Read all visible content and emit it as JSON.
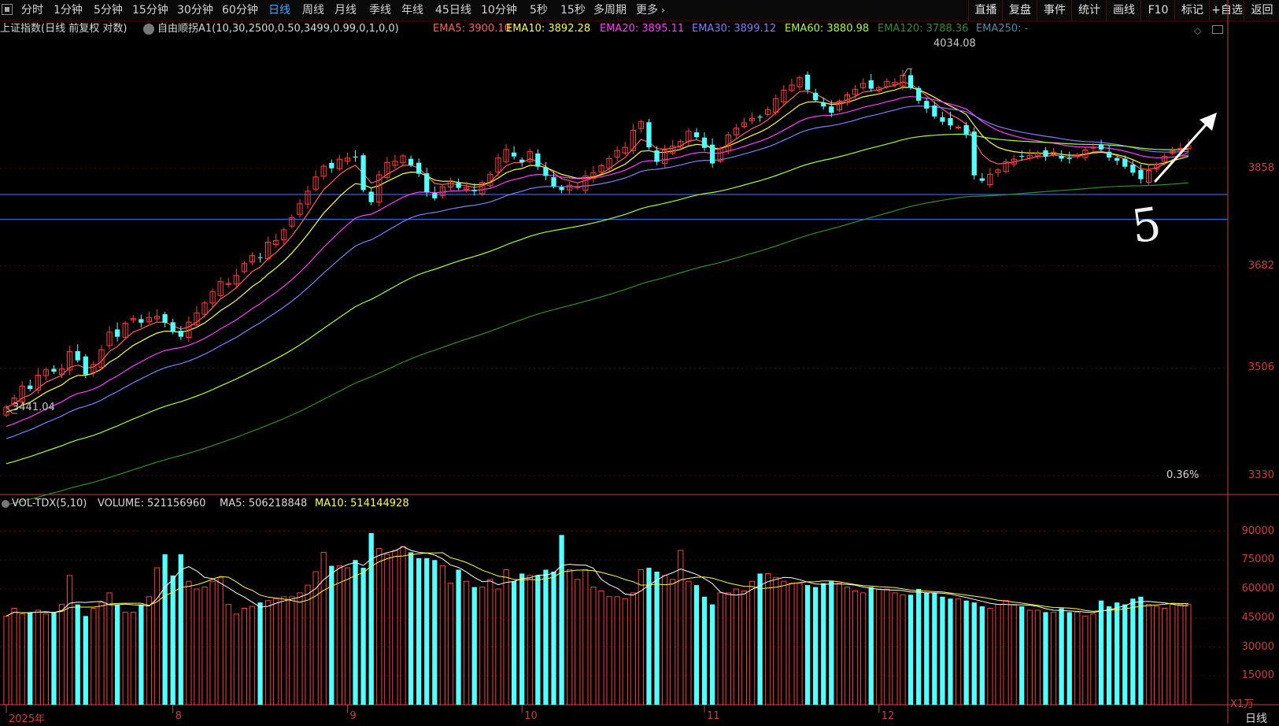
{
  "toolbar": {
    "tabs": [
      "分时",
      "1分钟",
      "5分钟",
      "15分钟",
      "30分钟",
      "60分钟",
      "日线",
      "周线",
      "月线",
      "季线",
      "年线",
      "45日线",
      "10分钟",
      "5秒",
      "15秒",
      "多周期",
      "更多"
    ],
    "active_tab": "日线",
    "right": [
      "直播",
      "复盘",
      "事件",
      "统计",
      "画线",
      "F10",
      "标记",
      "+自选",
      "返回"
    ]
  },
  "main_info": {
    "index_label": "上证指数(日线 前复权 对数)",
    "formula": "自由顺拐A1(10,30,2500,0.50,3499,0.99,0,1,0,0)",
    "ema": [
      {
        "label": "EMA5: 3900.10",
        "color": "#ff6060"
      },
      {
        "label": "EMA10: 3892.28",
        "color": "#ffff40"
      },
      {
        "label": "EMA20: 3895.11",
        "color": "#ff3cff"
      },
      {
        "label": "EMA30: 3899.12",
        "color": "#7f7fff"
      },
      {
        "label": "EMA60: 3880.98",
        "color": "#a6ff2f"
      },
      {
        "label": "EMA120: 3788.36",
        "color": "#2f8f2f"
      },
      {
        "label": "EMA250: -",
        "color": "#4a8fa8"
      }
    ]
  },
  "vol_info": {
    "title": "VOL-TDX(5,10)",
    "volume": "VOLUME: 521156960",
    "ma5": "MA5: 506218848",
    "ma10": "MA10: 514144928",
    "ma10_color": "#ffff40"
  },
  "annotations": {
    "high_label": "4034.08",
    "low_label": "3441.04",
    "percent_label": "0.36%",
    "handwritten": "5"
  },
  "price_axis_labels": [
    "3858",
    "3682",
    "3506",
    "3330"
  ],
  "volume_axis_labels": [
    "90000",
    "75000",
    "60000",
    "45000",
    "30000",
    "15000"
  ],
  "volume_unit": "X1万",
  "x_labels": [
    "2025年",
    "8",
    "9",
    "10",
    "11",
    "12"
  ],
  "bottom_right": "日线",
  "colors": {
    "up": "#ff3b3b",
    "down": "#54ffff",
    "grid": "#5a0000",
    "hline": "#2f6ad8",
    "axis": "#d23c3c"
  },
  "chart_data": [
    {
      "type": "candlestick",
      "title": "上证指数 日线",
      "y_scale": "log",
      "ylim": [
        3300,
        4110
      ],
      "y_ticks": [
        3858,
        3682,
        3506,
        3330
      ],
      "x_month_labels": [
        "2025年",
        "8",
        "9",
        "10",
        "11",
        "12"
      ],
      "horizontal_lines": [
        3810,
        3765
      ],
      "marked_high": 4034.08,
      "marked_low": 3441.04,
      "closes": [
        3441,
        3456,
        3476,
        3471,
        3494,
        3503,
        3500,
        3505,
        3534,
        3519,
        3495,
        3512,
        3537,
        3567,
        3559,
        3582,
        3590,
        3583,
        3592,
        3594,
        3583,
        3567,
        3559,
        3584,
        3600,
        3617,
        3637,
        3654,
        3651,
        3665,
        3686,
        3700,
        3696,
        3724,
        3727,
        3746,
        3768,
        3793,
        3816,
        3842,
        3862,
        3858,
        3875,
        3877,
        3878,
        3818,
        3796,
        3846,
        3869,
        3871,
        3881,
        3864,
        3848,
        3814,
        3803,
        3824,
        3835,
        3822,
        3823,
        3816,
        3832,
        3847,
        3877,
        3893,
        3880,
        3869,
        3889,
        3861,
        3844,
        3825,
        3818,
        3827,
        3824,
        3844,
        3850,
        3863,
        3876,
        3891,
        3897,
        3929,
        3945,
        3897,
        3870,
        3892,
        3899,
        3908,
        3927,
        3916,
        3896,
        3867,
        3895,
        3920,
        3933,
        3943,
        3951,
        3953,
        3968,
        3989,
        4005,
        4015,
        4029,
        4006,
        3986,
        3974,
        3962,
        3984,
        3996,
        4007,
        4018,
        4008,
        4010,
        4022,
        4020,
        4034,
        4010,
        3985,
        3970,
        3955,
        3945,
        3938,
        3935,
        3920,
        3845,
        3835,
        3847,
        3855,
        3870,
        3875,
        3880,
        3882,
        3887,
        3880,
        3888,
        3876,
        3875,
        3883,
        3892,
        3897,
        3893,
        3878,
        3872,
        3861,
        3850,
        3838,
        3854,
        3866,
        3880,
        3890,
        3895,
        3900
      ],
      "volume": {
        "unit": "万",
        "ylim": [
          0,
          100000
        ],
        "y_ticks": [
          90000,
          75000,
          60000,
          45000,
          30000,
          15000
        ],
        "values": [
          46000,
          50000,
          47000,
          48000,
          49000,
          47000,
          48000,
          52000,
          67000,
          52000,
          46000,
          50000,
          53000,
          58000,
          52000,
          48000,
          48000,
          52000,
          56000,
          71000,
          78000,
          67000,
          78000,
          64000,
          60000,
          61000,
          64000,
          66000,
          52000,
          47000,
          50000,
          51000,
          53000,
          54000,
          55000,
          56000,
          56000,
          58000,
          62000,
          69000,
          79000,
          72000,
          72000,
          71000,
          75000,
          71000,
          89000,
          81000,
          78000,
          80000,
          82000,
          79000,
          76000,
          76000,
          75000,
          72000,
          63000,
          70000,
          64000,
          61000,
          61000,
          65000,
          60000,
          70000,
          64000,
          68000,
          67000,
          67000,
          70000,
          69000,
          88000,
          70000,
          65000,
          70000,
          61000,
          59000,
          56000,
          56000,
          55000,
          58000,
          70000,
          71000,
          69000,
          67000,
          65000,
          80000,
          64000,
          62000,
          56000,
          52000,
          58000,
          58000,
          60000,
          59000,
          64000,
          68000,
          68000,
          66000,
          64000,
          63000,
          63000,
          62000,
          61000,
          63000,
          64000,
          63000,
          61000,
          59000,
          58000,
          61000,
          60000,
          60000,
          58000,
          57000,
          57000,
          60000,
          58000,
          58000,
          56000,
          55000,
          55000,
          54000,
          53000,
          51000,
          50000,
          52000,
          54000,
          52000,
          51000,
          49000,
          49000,
          48000,
          48000,
          50000,
          48000,
          48000,
          46000,
          47000,
          54000,
          51000,
          53000,
          52000,
          55000,
          56000,
          52000,
          51000,
          50000,
          52000,
          52000,
          52000
        ]
      }
    }
  ]
}
